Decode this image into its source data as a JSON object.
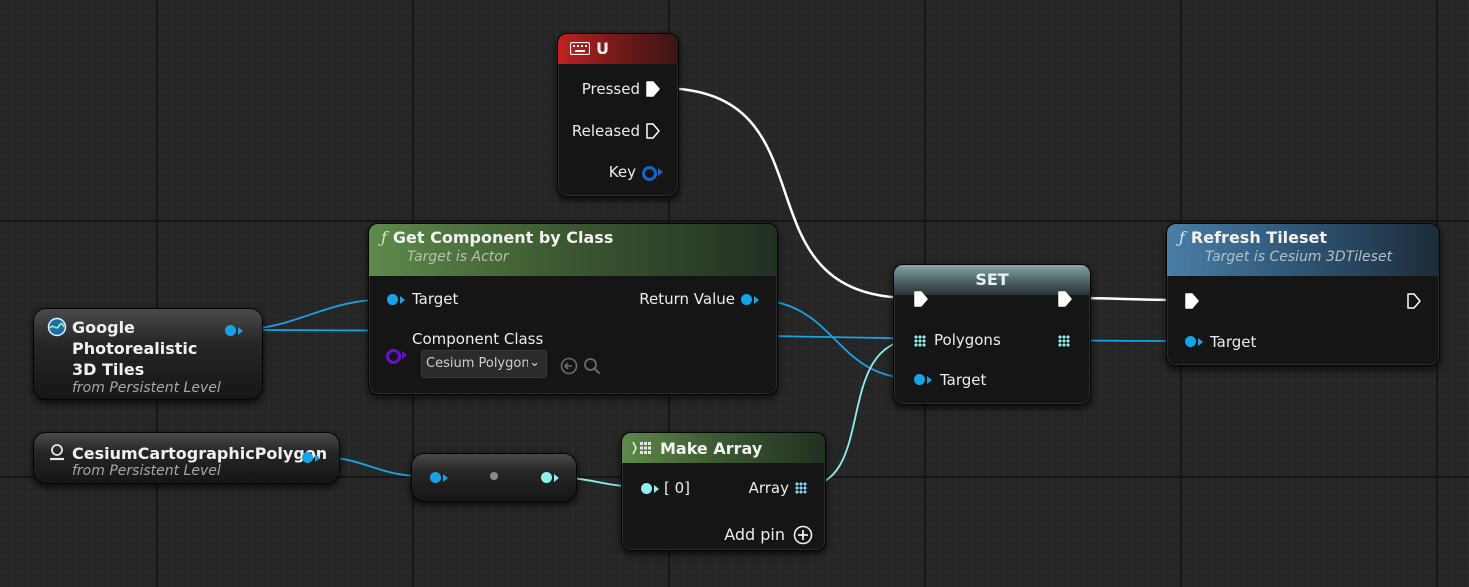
{
  "input_event_node": {
    "title": "U",
    "icon": "keyboard-icon",
    "header_color": "#b32020",
    "pins": {
      "pressed": "Pressed",
      "released": "Released",
      "key": "Key"
    }
  },
  "get_component_node": {
    "title": "Get Component by Class",
    "subtitle": "Target is Actor",
    "header_color": "#5f8a4b",
    "pins": {
      "target": "Target",
      "return_value": "Return Value",
      "component_class": "Component Class"
    },
    "class_dropdown": {
      "selected": "Cesium Polygon"
    }
  },
  "set_node": {
    "title": "SET",
    "header_color": "#6d8c8e",
    "pins": {
      "polygons": "Polygons",
      "target": "Target"
    }
  },
  "refresh_node": {
    "title": "Refresh Tileset",
    "subtitle": "Target is Cesium 3DTileset",
    "header_color": "#4a7ea8",
    "pins": {
      "target": "Target"
    }
  },
  "google_tiles_var": {
    "title": "Google Photorealistic 3D Tiles",
    "subtitle": "from Persistent Level",
    "icon": "globe-icon"
  },
  "polygon_var": {
    "title": "CesiumCartographicPolygon",
    "subtitle": "from Persistent Level",
    "icon": "polygon-actor-icon"
  },
  "make_array_node": {
    "title": "Make Array",
    "pins": {
      "index0": "[ 0]",
      "array": "Array",
      "add_pin": "Add pin"
    }
  },
  "colors": {
    "object_pin": "#17a3e8",
    "array_pin": "#8ef0ef",
    "class_pin": "#6a0fd0",
    "exec_wire": "#ffffff"
  }
}
